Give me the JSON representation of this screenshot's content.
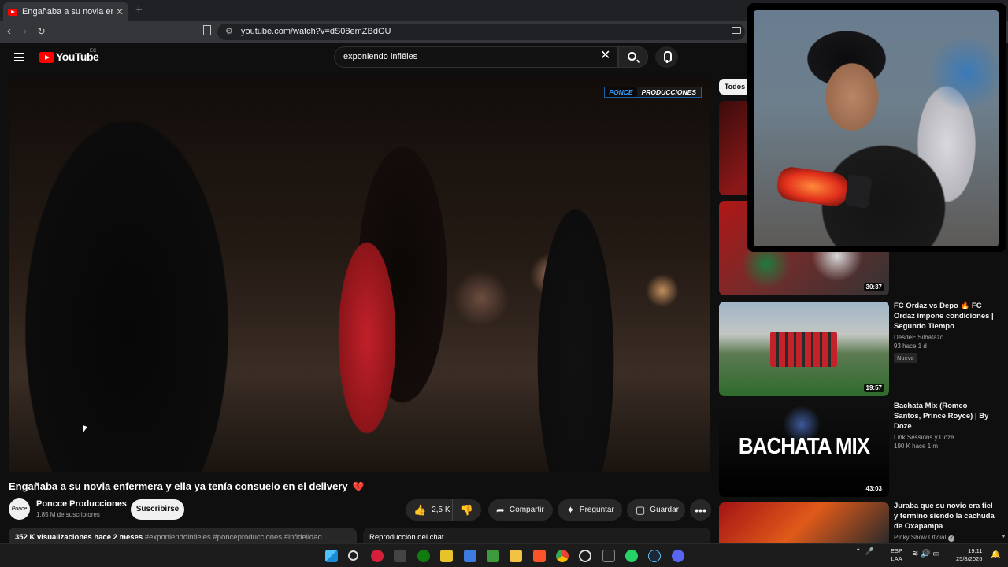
{
  "browser": {
    "tab_title": "Engañaba a su novia enfermera",
    "url": "youtube.com/watch?v=dS08emZBdGU"
  },
  "youtube": {
    "logo_text": "YouTube",
    "region": "EC",
    "search_query": "exponiendo infiēles"
  },
  "player": {
    "brand_a": "PONCE",
    "brand_b": "PRODUCCIONES"
  },
  "video": {
    "title": "Engañaba a su novia enfermera y ella ya tenía consuelo en el delivery",
    "title_emoji": "💔",
    "channel": "Poncce Producciones",
    "subscribers": "1,85 M de suscriptores",
    "subscribe_label": "Suscribirse",
    "likes": "2,5 K",
    "share_label": "Compartir",
    "ask_label": "Preguntar",
    "save_label": "Guardar",
    "views": "352 K visualizaciones",
    "date": "hace 2 meses",
    "hashtags": "#exponiendoinfieles #ponceproducciones #infidelidad",
    "chat_replay": "Reproducción del chat"
  },
  "sidebar": {
    "filter_all": "Todos",
    "videos": [
      {
        "duration": ""
      },
      {
        "duration": "30:37"
      },
      {
        "title": "FC Ordaz vs Depo 🔥 FC Ordaz impone condiciones | Segundo Tiempo",
        "channel": "DesdeElSilbatazo",
        "meta": "93  hace 1 d",
        "badge": "Nuevo",
        "duration": "19:57"
      },
      {
        "title": "Bachata Mix (Romeo Santos, Prince Royce) | By Doze",
        "channel": "Link Sessions y Doze",
        "meta": "190 K  hace 1 m",
        "thumb_text": "BACHATA MIX",
        "duration": "43:03"
      },
      {
        "title": "Juraba que su novio era fiel y termino siendo la cachuda de Oxapampa",
        "channel": "Pinky Show Oficial"
      }
    ]
  },
  "taskbar": {
    "lang1": "ESP",
    "lang2": "LAA",
    "time": "19:11",
    "date": "25/8/2026"
  }
}
